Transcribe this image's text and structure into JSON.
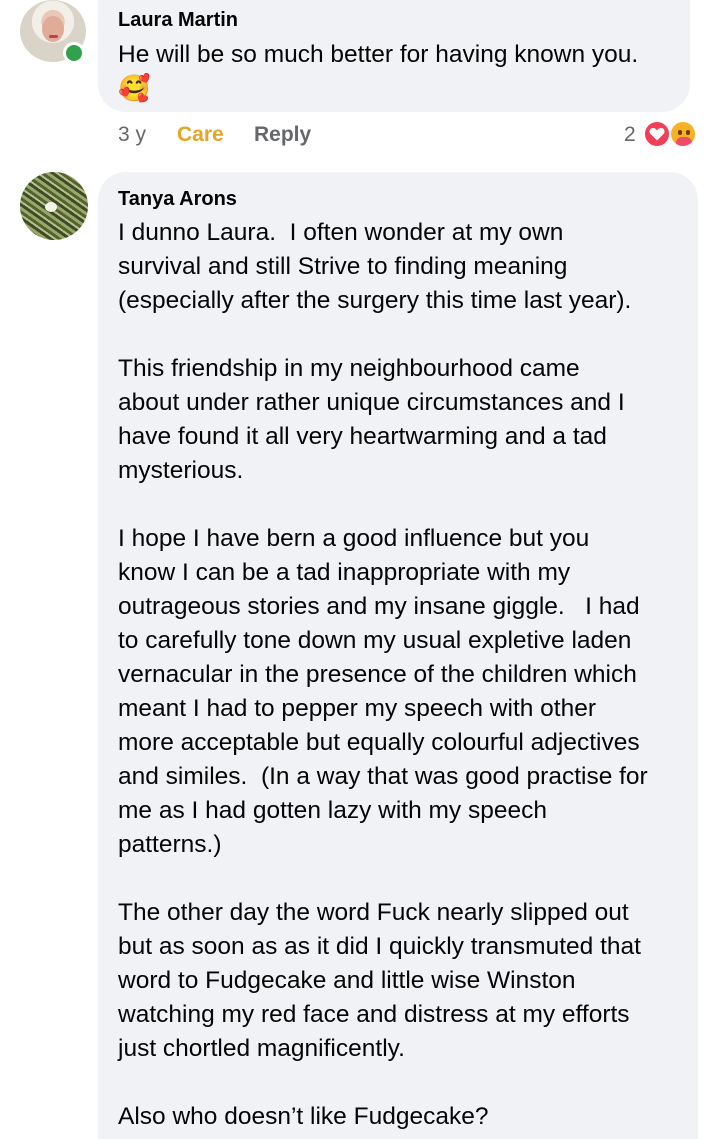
{
  "comments": [
    {
      "author": "Laura Martin",
      "text": "He will be so much better for having known you.",
      "emoji": "🥰",
      "online": true,
      "meta": {
        "time": "3 y",
        "reaction_label": "Care",
        "reply_label": "Reply",
        "reaction_count": "2",
        "reaction_icons": [
          "heart-icon",
          "care-icon"
        ]
      }
    },
    {
      "author": "Tanya Arons",
      "text": "I dunno Laura.  I often wonder at my own\nsurvival and still Strive to finding meaning\n(especially after the surgery this time last year).\n\nThis friendship in my neighbourhood came\nabout under rather unique circumstances and I\nhave found it all very heartwarming and a tad\nmysterious.\n\nI hope I have bern a good influence but you\nknow I can be a tad inappropriate with my\noutrageous stories and my insane giggle.   I had\nto carefully tone down my usual expletive laden\nvernacular in the presence of the children which\nmeant I had to pepper my speech with other\nmore acceptable but equally colourful adjectives\nand similes.  (In a way that was good practise for\nme as I had gotten lazy with my speech\npatterns.)\n\nThe other day the word Fuck nearly slipped out\nbut as soon as as it did I quickly transmuted that\nword to Fudgecake and little wise Winston\nwatching my red face and distress at my efforts\njust chortled magnificently.\n\nAlso who doesn’t like Fudgecake?"
    }
  ],
  "colors": {
    "bubble": "#f0f2f5",
    "care_accent": "#e5a526",
    "secondary_text": "#65676b",
    "online": "#31a24c",
    "heart": "#f33e58"
  }
}
